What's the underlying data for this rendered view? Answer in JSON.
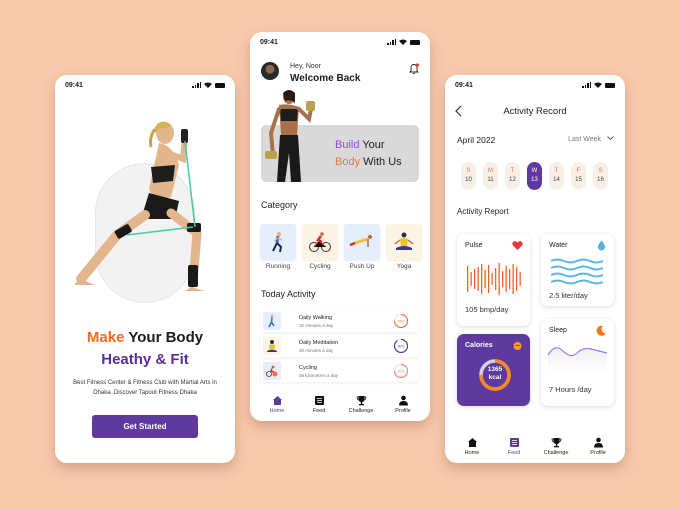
{
  "status_bar": {
    "time": "09:41"
  },
  "onboarding": {
    "headline_accent": "Make",
    "headline_rest": " Your Body",
    "headline_line2": "Heathy & Fit",
    "description": "Best Fitness Center & Fitness Club with Martial Arts in Dhaka .Discover Tapout Fitness Dhaka",
    "cta_label": "Get Started"
  },
  "home": {
    "greeting": "Hey, Noor",
    "welcome": "Welcome Back",
    "banner": {
      "w1": "Build",
      "w2": " Your",
      "w3": "Body",
      "w4": " With Us"
    },
    "category_title": "Category",
    "categories": [
      {
        "label": "Running",
        "icon": "running-icon"
      },
      {
        "label": "Cycling",
        "icon": "cycling-icon"
      },
      {
        "label": "Push Up",
        "icon": "pushup-icon"
      },
      {
        "label": "Yoga",
        "icon": "yoga-icon"
      }
    ],
    "activity_title": "Today Activity",
    "activities": [
      {
        "title": "Daily Walking",
        "subtitle": "30 minutes a day",
        "progress_label": "75%",
        "progress": 0.75,
        "color": "#f2743a"
      },
      {
        "title": "Daily Meditation",
        "subtitle": "30 minutes a day",
        "progress_label": "90%",
        "progress": 0.9,
        "color": "#5e3a9e"
      },
      {
        "title": "Cycling",
        "subtitle": "05 kilometers a day",
        "progress_label": "75%",
        "progress": 0.75,
        "color": "#f28a7a"
      }
    ]
  },
  "tabbar": {
    "home": "Home",
    "feed": "Feed",
    "challenge": "Challenge",
    "profile": "Profile"
  },
  "record": {
    "title": "Activity Record",
    "month": "April 2022",
    "range": "Last Week",
    "days": [
      {
        "l": "S",
        "n": "10"
      },
      {
        "l": "M",
        "n": "11"
      },
      {
        "l": "T",
        "n": "12"
      },
      {
        "l": "W",
        "n": "13",
        "selected": true
      },
      {
        "l": "T",
        "n": "14"
      },
      {
        "l": "F",
        "n": "15"
      },
      {
        "l": "S",
        "n": "16"
      }
    ],
    "report_title": "Activity Report",
    "pulse": {
      "title": "Pulse",
      "value": "105 bmp/day"
    },
    "water": {
      "title": "Water",
      "value": "2.5 liter/day"
    },
    "calories": {
      "title": "Calories",
      "value": "1365",
      "unit": "kcal",
      "progress": 0.75
    },
    "sleep": {
      "title": "Sleep",
      "value": "7 Hours /day"
    }
  },
  "colors": {
    "primary": "#5e3a9e",
    "accent": "#f36b1b",
    "background": "#f9c9ac"
  }
}
